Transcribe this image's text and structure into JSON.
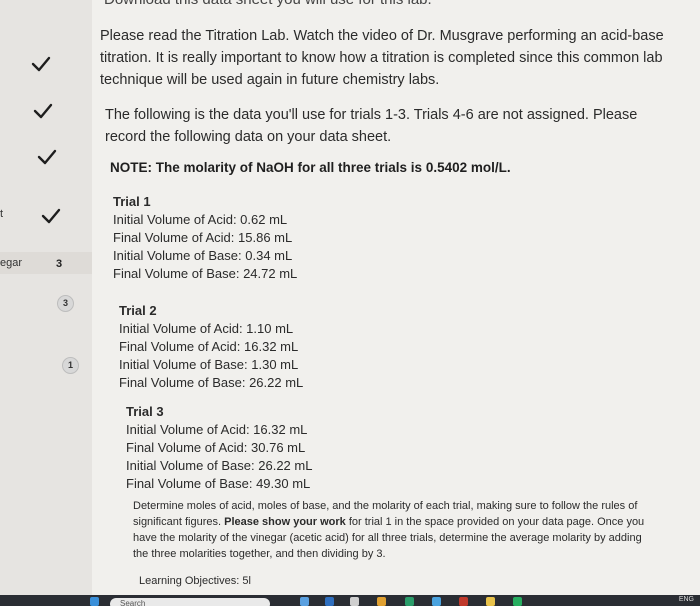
{
  "page_top_cut_text": "Download this data sheet you will use for this lab.",
  "intro_paragraph": "Please read the Titration Lab. Watch the video of Dr. Musgrave performing an acid-base titration. It is really important to know how a titration is completed since this common lab technique will be used again in future chemistry labs.",
  "data_paragraph": "The following is the data you'll use for trials 1-3. Trials 4-6 are not assigned. Please record the following data on your data sheet.",
  "note": "NOTE: The molarity of NaOH for all three trials is 0.5402 mol/L.",
  "trials": [
    {
      "title": "Trial 1",
      "lines": [
        "Initial Volume of Acid: 0.62 mL",
        "Final Volume of Acid: 15.86 mL",
        "Initial Volume of Base: 0.34 mL",
        "Final Volume of Base: 24.72 mL"
      ]
    },
    {
      "title": "Trial 2",
      "lines": [
        "Initial Volume of Acid: 1.10 mL",
        "Final Volume of Acid: 16.32 mL",
        "Initial Volume of Base: 1.30 mL",
        "Final Volume of Base: 26.22 mL"
      ]
    },
    {
      "title": "Trial 3",
      "lines": [
        "Initial Volume of Acid: 16.32 mL",
        "Final Volume of Acid: 30.76 mL",
        "Initial Volume of Base: 26.22 mL",
        "Final Volume of Base: 49.30 mL"
      ]
    }
  ],
  "instructions": {
    "part1": "Determine moles of acid, moles of base, and the molarity of each trial, making sure to follow the rules of significant figures.",
    "bold": "Please show your work",
    "part2": "for trial 1 in the space provided on your data page. Once you have the molarity of the vinegar (acetic acid) for all three trials, determine the average molarity by adding the three molarities together, and then dividing by 3."
  },
  "objectives": "Learning Objectives: 5l",
  "sidebar": {
    "partial_label": "egar",
    "partial_mark": "t",
    "count_value": "3",
    "badges": [
      "3",
      "1"
    ],
    "checks": 4
  },
  "taskbar": {
    "search_placeholder": "Search",
    "lang": "ENG"
  },
  "colors": {
    "check": "#1e1e1e",
    "content_bg": "#f1f0ed",
    "sidebar_bg": "#e6e4e1"
  }
}
